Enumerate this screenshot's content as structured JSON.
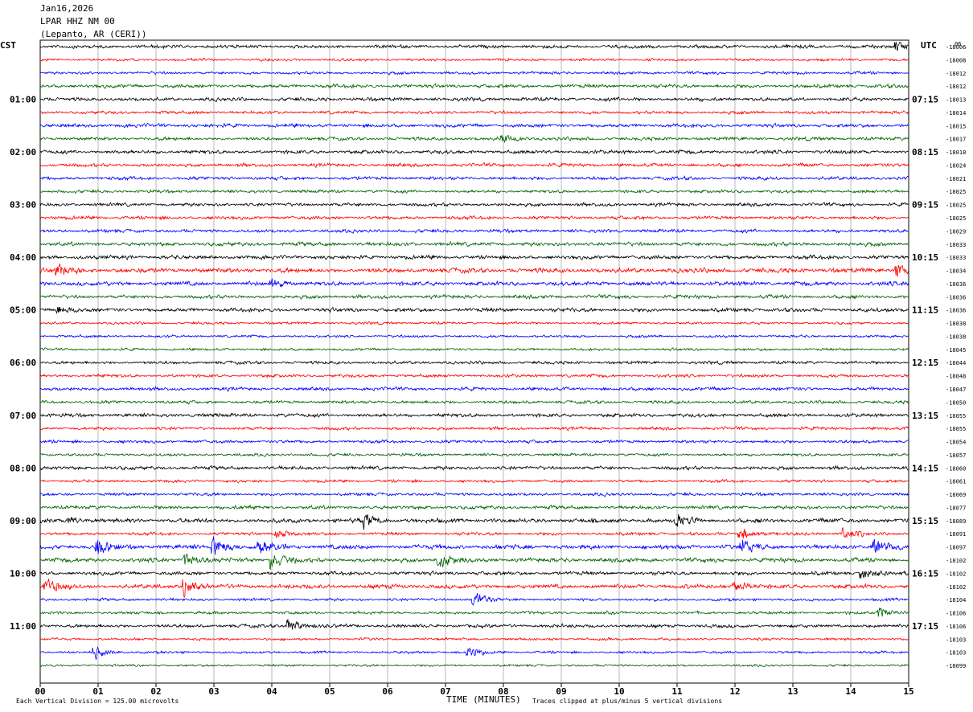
{
  "header": {
    "date": "Jan16,2026",
    "station": "LPAR HHZ NM 00",
    "location": "(Lepanto, AR (CERI))"
  },
  "left_zone_label": "CST",
  "right_zone_label": "UTC",
  "footer": {
    "scale": "Each Vertical Division =  125.00 microvolts",
    "x_title": "TIME (MINUTES)",
    "clip_note": "Traces clipped at plus/minus 5 vertical divisions"
  },
  "chart_data": {
    "type": "line",
    "title": "",
    "xlabel": "TIME (MINUTES)",
    "ylabel": "",
    "x_range": [
      0,
      15
    ],
    "x_ticks": [
      "00",
      "01",
      "02",
      "03",
      "04",
      "05",
      "06",
      "07",
      "08",
      "09",
      "10",
      "11",
      "12",
      "13",
      "14",
      "15"
    ],
    "grid": "vertical lines each minute",
    "trace_colors": [
      "#000000",
      "#ff0000",
      "#0000ff",
      "#006400"
    ],
    "left_time_labels": [
      {
        "row": 4,
        "label": "01:00"
      },
      {
        "row": 8,
        "label": "02:00"
      },
      {
        "row": 12,
        "label": "03:00"
      },
      {
        "row": 16,
        "label": "04:00"
      },
      {
        "row": 20,
        "label": "05:00"
      },
      {
        "row": 24,
        "label": "06:00"
      },
      {
        "row": 28,
        "label": "07:00"
      },
      {
        "row": 32,
        "label": "08:00"
      },
      {
        "row": 36,
        "label": "09:00"
      },
      {
        "row": 40,
        "label": "10:00"
      },
      {
        "row": 44,
        "label": "11:00"
      }
    ],
    "right_time_labels": [
      {
        "row": 4,
        "label": "07:15"
      },
      {
        "row": 8,
        "label": "08:15"
      },
      {
        "row": 12,
        "label": "09:15"
      },
      {
        "row": 16,
        "label": "10:15"
      },
      {
        "row": 20,
        "label": "11:15"
      },
      {
        "row": 24,
        "label": "12:15"
      },
      {
        "row": 28,
        "label": "13:15"
      },
      {
        "row": 32,
        "label": "14:15"
      },
      {
        "row": 36,
        "label": "15:15"
      },
      {
        "row": 40,
        "label": "16:15"
      },
      {
        "row": 44,
        "label": "17:15"
      }
    ],
    "right_top_label": "06",
    "trace_offsets": [
      "-18006",
      "-18008",
      "-18012",
      "-18012",
      "-18013",
      "-18014",
      "-18015",
      "-18017",
      "-18018",
      "-18024",
      "-18021",
      "-18025",
      "-18025",
      "-18025",
      "-18029",
      "-18033",
      "-18033",
      "-18034",
      "-18036",
      "-18036",
      "-18036",
      "-18038",
      "-18038",
      "-18045",
      "-18044",
      "-18048",
      "-18047",
      "-18050",
      "-18055",
      "-18055",
      "-18054",
      "-18057",
      "-18060",
      "-18061",
      "-18069",
      "-18077",
      "-18089",
      "-18091",
      "-18097",
      "-18102",
      "-18102",
      "-18102",
      "-18104",
      "-18106",
      "-18106",
      "-18103",
      "-18103",
      "-18099"
    ],
    "trace_amplitudes": [
      2.4,
      1.8,
      2.0,
      2.6,
      2.6,
      2.2,
      2.6,
      2.4,
      2.6,
      2.4,
      2.4,
      2.2,
      2.4,
      2.4,
      2.4,
      2.8,
      2.8,
      3.4,
      3.0,
      2.6,
      2.8,
      1.8,
      1.8,
      1.8,
      2.2,
      2.2,
      2.4,
      2.2,
      2.6,
      2.2,
      2.2,
      2.0,
      2.6,
      2.0,
      2.2,
      2.6,
      3.0,
      2.2,
      3.2,
      3.0,
      2.6,
      3.0,
      2.0,
      2.0,
      2.4,
      1.8,
      1.8,
      1.6
    ],
    "events": [
      {
        "row": 36,
        "minute": 0.5,
        "amplitude": 7
      },
      {
        "row": 36,
        "minute": 5.6,
        "amplitude": 10
      },
      {
        "row": 36,
        "minute": 11.0,
        "amplitude": 12
      },
      {
        "row": 37,
        "minute": 4.1,
        "amplitude": 8
      },
      {
        "row": 37,
        "minute": 12.1,
        "amplitude": 12
      },
      {
        "row": 37,
        "minute": 13.9,
        "amplitude": 10
      },
      {
        "row": 38,
        "minute": 1.0,
        "amplitude": 14
      },
      {
        "row": 38,
        "minute": 3.0,
        "amplitude": 16
      },
      {
        "row": 38,
        "minute": 3.8,
        "amplitude": 14
      },
      {
        "row": 38,
        "minute": 12.1,
        "amplitude": 14
      },
      {
        "row": 38,
        "minute": 14.4,
        "amplitude": 14
      },
      {
        "row": 39,
        "minute": 2.5,
        "amplitude": 14
      },
      {
        "row": 39,
        "minute": 4.0,
        "amplitude": 16
      },
      {
        "row": 39,
        "minute": 6.9,
        "amplitude": 14
      },
      {
        "row": 40,
        "minute": 14.2,
        "amplitude": 10
      },
      {
        "row": 41,
        "minute": 0.1,
        "amplitude": 14
      },
      {
        "row": 41,
        "minute": 2.5,
        "amplitude": 14
      },
      {
        "row": 41,
        "minute": 12.0,
        "amplitude": 10
      },
      {
        "row": 42,
        "minute": 7.5,
        "amplitude": 14
      },
      {
        "row": 43,
        "minute": 14.5,
        "amplitude": 10
      },
      {
        "row": 44,
        "minute": 4.3,
        "amplitude": 12
      },
      {
        "row": 46,
        "minute": 0.95,
        "amplitude": 10
      },
      {
        "row": 46,
        "minute": 7.4,
        "amplitude": 10
      },
      {
        "row": 17,
        "minute": 14.8,
        "amplitude": 10
      },
      {
        "row": 17,
        "minute": 0.3,
        "amplitude": 8
      },
      {
        "row": 18,
        "minute": 4.0,
        "amplitude": 8
      },
      {
        "row": 20,
        "minute": 0.3,
        "amplitude": 8
      },
      {
        "row": 0,
        "minute": 14.8,
        "amplitude": 8
      },
      {
        "row": 7,
        "minute": 8.0,
        "amplitude": 7
      }
    ]
  }
}
